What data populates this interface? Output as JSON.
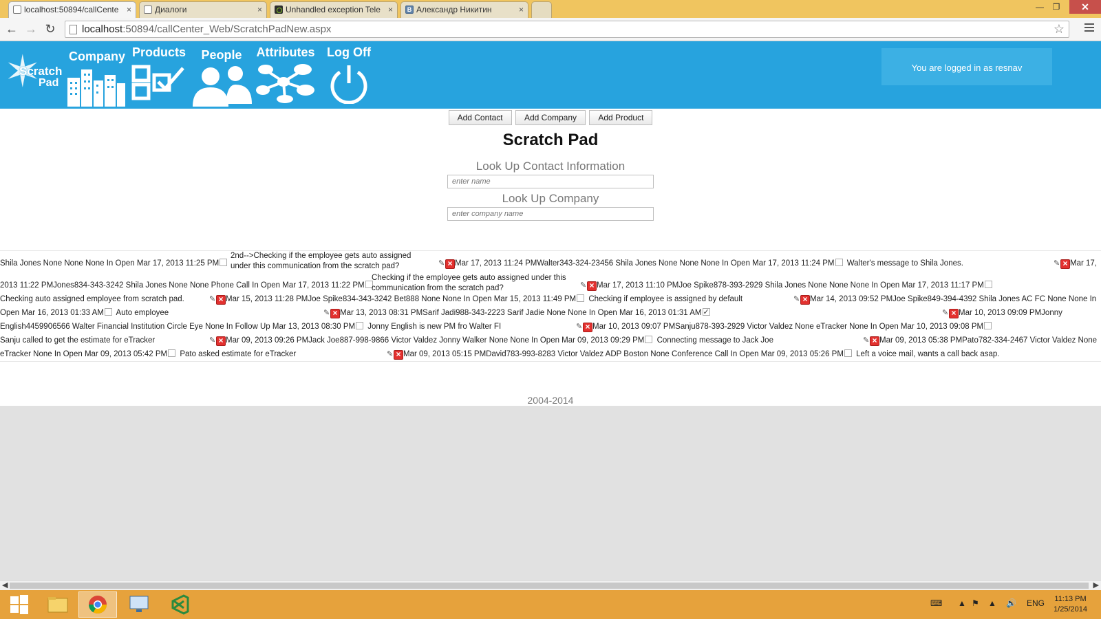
{
  "browser": {
    "tabs": [
      {
        "title": "localhost:50894/callCente",
        "active": true
      },
      {
        "title": "Диалоги",
        "active": false
      },
      {
        "title": "Unhandled exception Tele",
        "active": false
      },
      {
        "title": "Александр Никитин",
        "active": false
      }
    ],
    "close_glyph": "×",
    "url_host": "localhost",
    "url_rest": ":50894/callCenter_Web/ScratchPadNew.aspx"
  },
  "site": {
    "logo_line1": "Scratch",
    "logo_line2": "Pad",
    "nav": [
      {
        "label": "Company",
        "icon": "buildings-icon"
      },
      {
        "label": "Products",
        "icon": "products-checkbox-icon"
      },
      {
        "label": "People",
        "icon": "people-icon"
      },
      {
        "label": "Attributes",
        "icon": "attributes-network-icon"
      },
      {
        "label": "Log Off",
        "icon": "power-icon"
      }
    ],
    "logged_in_text": "You are logged in as resnav"
  },
  "actions": {
    "add_contact": "Add Contact",
    "add_company": "Add Company",
    "add_product": "Add Product"
  },
  "page_title": "Scratch Pad",
  "lookup_contact": {
    "label": "Look Up Contact Information",
    "placeholder": "enter name"
  },
  "lookup_company": {
    "label": "Look Up Company",
    "placeholder": "enter company name"
  },
  "records": {
    "lines": [
      "Shila Jones None None None In Open Mar 17, 2013 11:25 PM",
      "2013 11:22 PMJones834-343-3242 Shila Jones None None Phone Call In Open Mar 17, 2013 11:22 PM",
      "Checking auto assigned employee from scratch pad.",
      "Open Mar 16, 2013 01:33 AM",
      "English4459906566 Walter Financial Institution Circle Eye None In Follow Up Mar 13, 2013 08:30 PM",
      "Sanju called to get the estimate for eTracker",
      "eTracker None In Open Mar 09, 2013 05:42 PM"
    ],
    "notes": [
      "2nd-->Checking if the employee gets auto assigned",
      "under this communication from the scratch pad?",
      "Checking if the employee gets auto assigned under this",
      "communication from the scratch pad?",
      "Auto employee",
      "Jonny English is new PM fro Walter FI",
      "Pato asked estimate for eTracker"
    ],
    "segments": [
      "Mar 17, 2013 11:24 PMWalter343-324-23456 Shila Jones None None None In Open Mar 17, 2013 11:24 PM",
      "Walter's message to Shila Jones.",
      "Mar 17,",
      "Mar 17, 2013 11:10 PMJoe Spike878-393-2929 Shila Jones None None None In Open Mar 17, 2013 11:17 PM",
      "Mar 15, 2013 11:28 PMJoe Spike834-343-3242 Bet888 None None In Open Mar 15, 2013 11:49 PM",
      "Checking if employee is assigned by default",
      "Mar 14, 2013 09:52 PMJoe Spike849-394-4392 Shila Jones AC FC None None In",
      "Mar 13, 2013 08:31 PMSarif Jadi988-343-2223 Sarif Jadie None None In Open Mar 16, 2013 01:31 AM",
      "Mar 10, 2013 09:09 PMJonny",
      "Mar 10, 2013 09:07 PMSanju878-393-2929 Victor Valdez None eTracker None In Open Mar 10, 2013 09:08 PM",
      "Mar 09, 2013 09:26 PMJack Joe887-998-9866 Victor Valdez Jonny Walker None None In Open Mar 09, 2013 09:29 PM",
      "Connecting message to Jack Joe",
      "Mar 09, 2013 05:38 PMPato782-334-2467 Victor Valdez None",
      "Mar 09, 2013 05:15 PMDavid783-993-8283 Victor Valdez ADP Boston None Conference Call In Open Mar 09, 2013 05:26 PM",
      "Left a voice mail, wants a call back asap."
    ]
  },
  "footer": "2004-2014",
  "taskbar": {
    "lang": "ENG",
    "time": "11:13 PM",
    "date": "1/25/2014"
  },
  "colors": {
    "header": "#27a3de",
    "tab_strip": "#f0c55f",
    "taskbar": "#e6a23c",
    "delete_icon": "#e3312f"
  }
}
